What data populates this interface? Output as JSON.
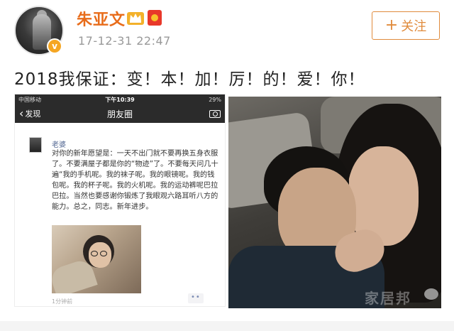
{
  "post": {
    "author_name": "朱亚文",
    "timestamp": "17-12-31 22:47",
    "follow_label": "关注",
    "follow_plus": "+",
    "verified_badge": "v",
    "text": "2018我保证：变！本！加！厉！的！爱！你！"
  },
  "screenshot": {
    "status_carrier": "中国移动",
    "status_time": "下午10:39",
    "status_battery": "29%",
    "nav_back": "发现",
    "nav_title": "朋友圈",
    "moment": {
      "author": "老婆",
      "text": "对你的新年愿望是：一天不出门就不要再换五身衣服了。不要满屋子都是你的“物迹”了。不要每天问几十遍“我的手机呢。我的袜子呢。我的眼镜呢。我的钱包呢。我的杯子呢。我的火机呢。我的运动裤呢巴拉巴拉。当然也要感谢你锻炼了我眼观六路耳听八方的能力。总之，同志。新年进步。",
      "time": "1分钟前"
    }
  },
  "photo": {
    "watermark": "家居邦"
  },
  "icons": {
    "crown": "crown-icon",
    "red_packet": "red-packet-icon",
    "camera": "camera-icon",
    "back": "chevron-left-icon",
    "weibo": "weibo-logo-icon"
  },
  "colors": {
    "name": "#e86c1a",
    "follow_border": "#e08b3c",
    "moment_name": "#576b95"
  }
}
